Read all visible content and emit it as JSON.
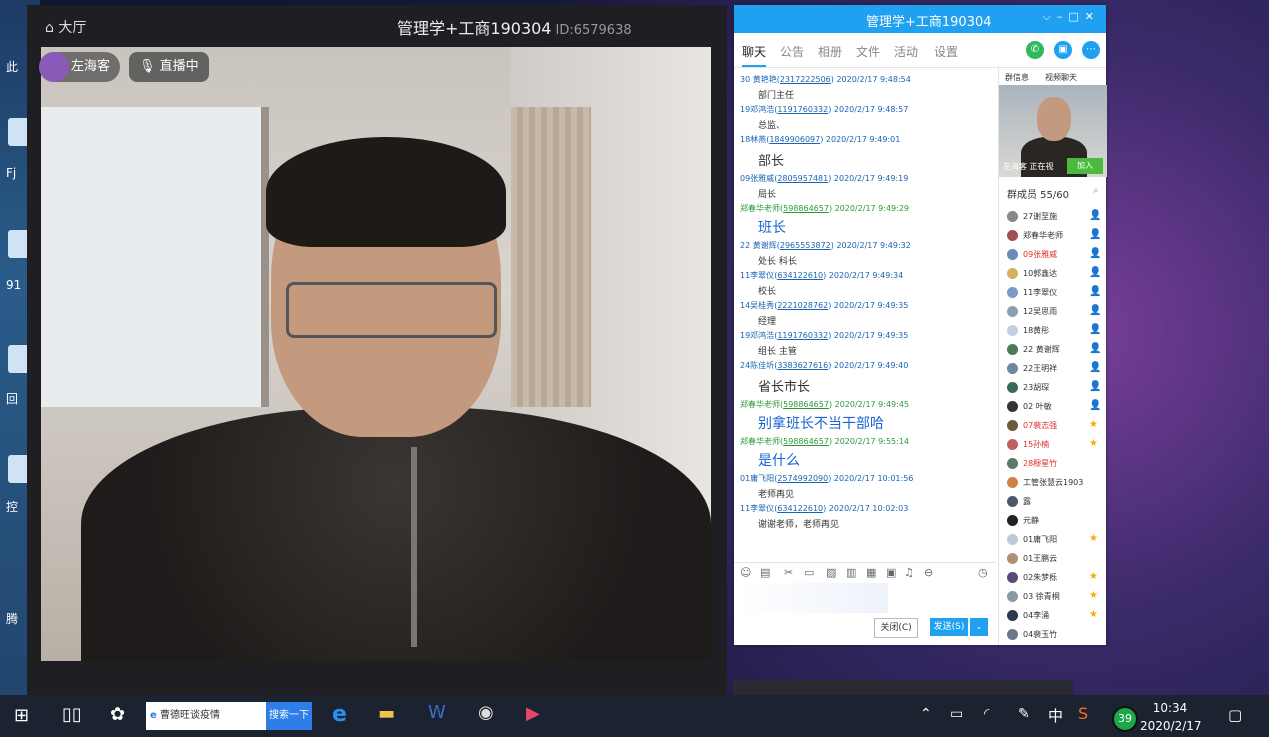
{
  "desktop": {
    "labels": [
      "此",
      "Fj",
      "91",
      "回",
      "控",
      "腾"
    ]
  },
  "live": {
    "hall_label": "大厅",
    "title": "管理学+工商190304",
    "room_id": "ID:6579638",
    "host_name": "左海客",
    "live_status": "直播中"
  },
  "chat": {
    "title": "管理学+工商190304",
    "tabs": [
      "聊天",
      "公告",
      "相册",
      "文件",
      "活动",
      "设置"
    ],
    "messages": [
      {
        "sender": "30 黄艳艳",
        "qq": "2317222506",
        "time": "2020/2/17 9:48:54",
        "text": "部门主任",
        "style": "normal",
        "color": "blue"
      },
      {
        "sender": "19邓鸿浩",
        "qq": "1191760332",
        "time": "2020/2/17 9:48:57",
        "text": "总监、",
        "style": "normal",
        "color": "blue"
      },
      {
        "sender": "18林燕",
        "qq": "1849906097",
        "time": "2020/2/17 9:49:01",
        "text": "部长",
        "style": "big",
        "color": "blue"
      },
      {
        "sender": "09张雅威",
        "qq": "2805957481",
        "time": "2020/2/17 9:49:19",
        "text": "局长",
        "style": "normal",
        "color": "blue"
      },
      {
        "sender": "郑春华老师",
        "qq": "598864657",
        "time": "2020/2/17 9:49:29",
        "text": "班长",
        "style": "blue",
        "color": "green"
      },
      {
        "sender": "22 黄谢辉",
        "qq": "2965553872",
        "time": "2020/2/17 9:49:32",
        "text": "处长 科长",
        "style": "normal",
        "color": "blue"
      },
      {
        "sender": "11李翠仪",
        "qq": "634122610",
        "time": "2020/2/17 9:49:34",
        "text": "校长",
        "style": "normal",
        "color": "blue"
      },
      {
        "sender": "14吴桂秀",
        "qq": "2221028762",
        "time": "2020/2/17 9:49:35",
        "text": "经理",
        "style": "normal",
        "color": "blue"
      },
      {
        "sender": "19邓鸿浩",
        "qq": "1191760332",
        "time": "2020/2/17 9:49:35",
        "text": "组长 主管",
        "style": "normal",
        "color": "blue"
      },
      {
        "sender": "24陈佳圻",
        "qq": "3383627616",
        "time": "2020/2/17 9:49:40",
        "text": "省长市长",
        "style": "big",
        "color": "blue"
      },
      {
        "sender": "郑春华老师",
        "qq": "598864657",
        "time": "2020/2/17 9:49:45",
        "text": "别拿班长不当干部哈",
        "style": "blue",
        "color": "green"
      },
      {
        "sender": "郑春华老师",
        "qq": "598864657",
        "time": "2020/2/17 9:55:14",
        "text": "是什么",
        "style": "blue",
        "color": "green"
      },
      {
        "sender": "01庸飞阳",
        "qq": "2574992090",
        "time": "2020/2/17 10:01:56",
        "text": "老师再见",
        "style": "normal",
        "color": "blue"
      },
      {
        "sender": "11李翠仪",
        "qq": "634122610",
        "time": "2020/2/17 10:02:03",
        "text": "谢谢老师，老师再见",
        "style": "normal",
        "color": "blue"
      }
    ],
    "close_label": "关闭(C)",
    "send_label": "发送(S)",
    "side_tabs": [
      "群信息",
      "视频聊天"
    ],
    "video_caption": "左海客 正在视",
    "join_label": "加入",
    "members_title": "群成员 55/60",
    "members": [
      {
        "name": "27谢至施",
        "red": false,
        "color": "#888",
        "badge": "👤"
      },
      {
        "name": "郑春华老师",
        "red": false,
        "color": "#a05050",
        "badge": "👤"
      },
      {
        "name": "09张雅威",
        "red": true,
        "color": "#6a8ab8",
        "badge": "👤"
      },
      {
        "name": "10郭鑫达",
        "red": false,
        "color": "#d4b25c",
        "badge": "👤"
      },
      {
        "name": "11李翠仪",
        "red": false,
        "color": "#7a9ac4",
        "badge": "👤"
      },
      {
        "name": "12吴思雨",
        "red": false,
        "color": "#8aa0b0",
        "badge": "👤"
      },
      {
        "name": "18黄彤",
        "red": false,
        "color": "#c0d0e0",
        "badge": "👤"
      },
      {
        "name": "22 黄谢辉",
        "red": false,
        "color": "#4a7a5a",
        "badge": "👤"
      },
      {
        "name": "22王明祥",
        "red": false,
        "color": "#6a8aa0",
        "badge": "👤"
      },
      {
        "name": "23胡琛",
        "red": false,
        "color": "#3a6a5a",
        "badge": "👤"
      },
      {
        "name": "02  叶敏",
        "red": false,
        "color": "#333",
        "badge": "👤"
      },
      {
        "name": "07裴志强",
        "red": true,
        "color": "#6a5a3a",
        "badge": "★"
      },
      {
        "name": "15孙楠",
        "red": true,
        "color": "#c06060",
        "badge": "★"
      },
      {
        "name": "28穆星竹",
        "red": true,
        "color": "#5a7a6a",
        "badge": ""
      },
      {
        "name": "工管张慧云1903",
        "red": false,
        "color": "#d08040",
        "badge": ""
      },
      {
        "name": "露",
        "red": false,
        "color": "#4a5a6a",
        "badge": ""
      },
      {
        "name": "元静",
        "red": false,
        "color": "#222",
        "badge": ""
      },
      {
        "name": "01庸飞阳",
        "red": false,
        "color": "#c0c8d8",
        "badge": "★"
      },
      {
        "name": "01王鹏云",
        "red": false,
        "color": "#b09070",
        "badge": ""
      },
      {
        "name": "02朱梦栎",
        "red": false,
        "color": "#5a4a7a",
        "badge": "★"
      },
      {
        "name": "03 徐青桐",
        "red": false,
        "color": "#8a9aa0",
        "badge": "★"
      },
      {
        "name": "04李涌",
        "red": false,
        "color": "#2a3a4a",
        "badge": "★"
      },
      {
        "name": "04裴玉竹",
        "red": false,
        "color": "#6a7a8a",
        "badge": ""
      }
    ]
  },
  "taskbar": {
    "search_text": "曹德旺谈疫情",
    "search_button": "搜索一下",
    "ime": "中",
    "badge": "39",
    "time": "10:34",
    "date": "2020/2/17"
  }
}
